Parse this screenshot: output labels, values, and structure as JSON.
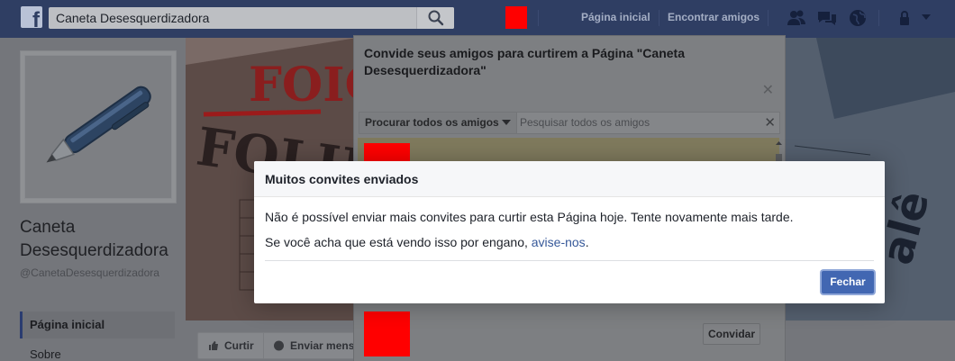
{
  "topbar": {
    "search_value": "Caneta Desesquerdizadora",
    "nav": [
      "Página inicial",
      "Encontrar amigos"
    ],
    "icons": [
      "facebook-logo",
      "search-icon",
      "friends-icon",
      "messages-icon",
      "globe-icon",
      "lock-icon",
      "dropdown-icon"
    ]
  },
  "page": {
    "name": "Caneta Desesquerdizadora",
    "handle": "@CanetaDesesquerdizadora",
    "sidebar": [
      "Página inicial",
      "Sobre"
    ],
    "actions": {
      "like": "Curtir",
      "message": "Enviar mens"
    }
  },
  "invite": {
    "title": "Convide seus amigos para curtirem a Página \"Caneta Desesquerdizadora\"",
    "filter_label": "Procurar todos os amigos",
    "search_placeholder": "Pesquisar todos os amigos",
    "invite_button": "Convidar"
  },
  "modal": {
    "title": "Muitos convites enviados",
    "line1": "Não é possível enviar mais convites para curtir esta Página hoje. Tente novamente mais tarde.",
    "line2_prefix": "Se você acha que está vendo isso por engano, ",
    "line2_link": "avise-nos",
    "line2_suffix": ".",
    "close_button": "Fechar"
  },
  "colors": {
    "facebook_blue": "#4267b2",
    "link": "#365899",
    "redaction": "#ff0000"
  }
}
